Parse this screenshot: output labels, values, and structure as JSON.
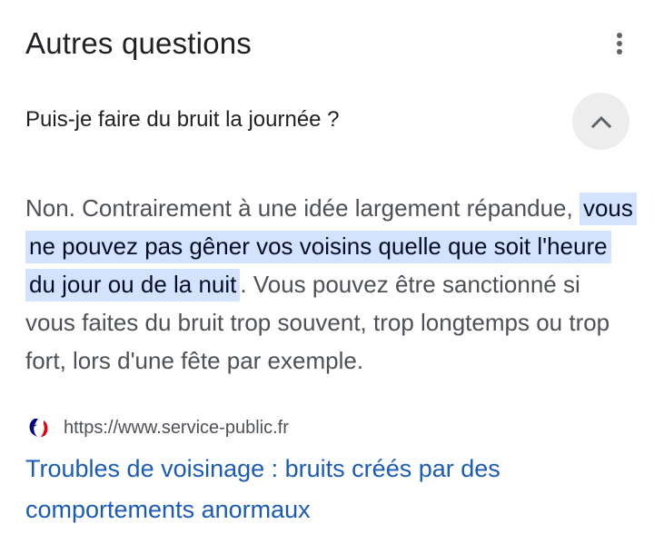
{
  "section": {
    "title": "Autres questions",
    "menu_icon": "more-vert-icon"
  },
  "question": {
    "text": "Puis-je faire du bruit la journée ?",
    "expanded": true,
    "toggle_icon": "chevron-up-icon"
  },
  "answer": {
    "intro": "Non. Contrairement à une idée largement répandue, ",
    "highlight": "vous ne pouvez pas gêner vos voisins quelle que soit l'heure du jour ou de la nuit",
    "outro": ". Vous pouvez être sanctionné si vous faites du bruit trop souvent, trop longtemps ou trop fort, lors d'une fête par exemple."
  },
  "source": {
    "favicon_icon": "marianne-logo-icon",
    "url": "https://www.service-public.fr",
    "link_title": "Troubles de voisinage : bruits créés par des comportements anormaux"
  },
  "colors": {
    "highlight_bg": "#d3e3fd",
    "link": "#1a5bb8",
    "toggle_bg": "#ededed"
  }
}
